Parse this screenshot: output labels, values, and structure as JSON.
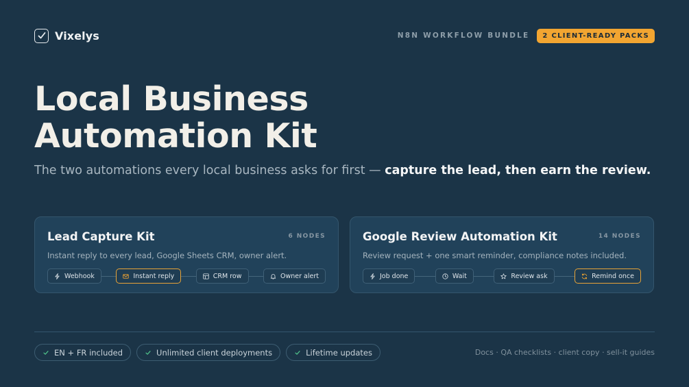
{
  "brand": {
    "name": "Vixelys",
    "icon": "check-square-icon"
  },
  "header": {
    "bundle_label": "N8N WORKFLOW BUNDLE",
    "badge": "2 CLIENT-READY PACKS"
  },
  "hero": {
    "title_line1": "Local Business",
    "title_line2": "Automation Kit",
    "subtitle_plain": "The two automations every local business asks for first — ",
    "subtitle_bold": "capture the lead, then earn the review."
  },
  "cards": [
    {
      "title": "Lead Capture Kit",
      "nodes": "6 NODES",
      "description": "Instant reply to every lead, Google Sheets CRM, owner alert.",
      "flow": [
        {
          "label": "Webhook",
          "icon": "bolt-icon",
          "active": false
        },
        {
          "label": "Instant reply",
          "icon": "mail-icon",
          "active": true
        },
        {
          "label": "CRM row",
          "icon": "table-icon",
          "active": false
        },
        {
          "label": "Owner alert",
          "icon": "bell-icon",
          "active": false
        }
      ]
    },
    {
      "title": "Google Review Automation Kit",
      "nodes": "14 NODES",
      "description": "Review request + one smart reminder, compliance notes included.",
      "flow": [
        {
          "label": "Job done",
          "icon": "bolt-icon",
          "active": false
        },
        {
          "label": "Wait",
          "icon": "clock-icon",
          "active": false
        },
        {
          "label": "Review ask",
          "icon": "star-icon",
          "active": false
        },
        {
          "label": "Remind once",
          "icon": "refresh-icon",
          "active": true
        }
      ]
    }
  ],
  "footer": {
    "pills": [
      "EN + FR included",
      "Unlimited client deployments",
      "Lifetime updates"
    ],
    "links": "Docs · QA checklists · client copy · sell-it guides"
  },
  "colors": {
    "background": "#1b3447",
    "card": "#21425a",
    "accent": "#f2a531",
    "check": "#4fc38a"
  }
}
